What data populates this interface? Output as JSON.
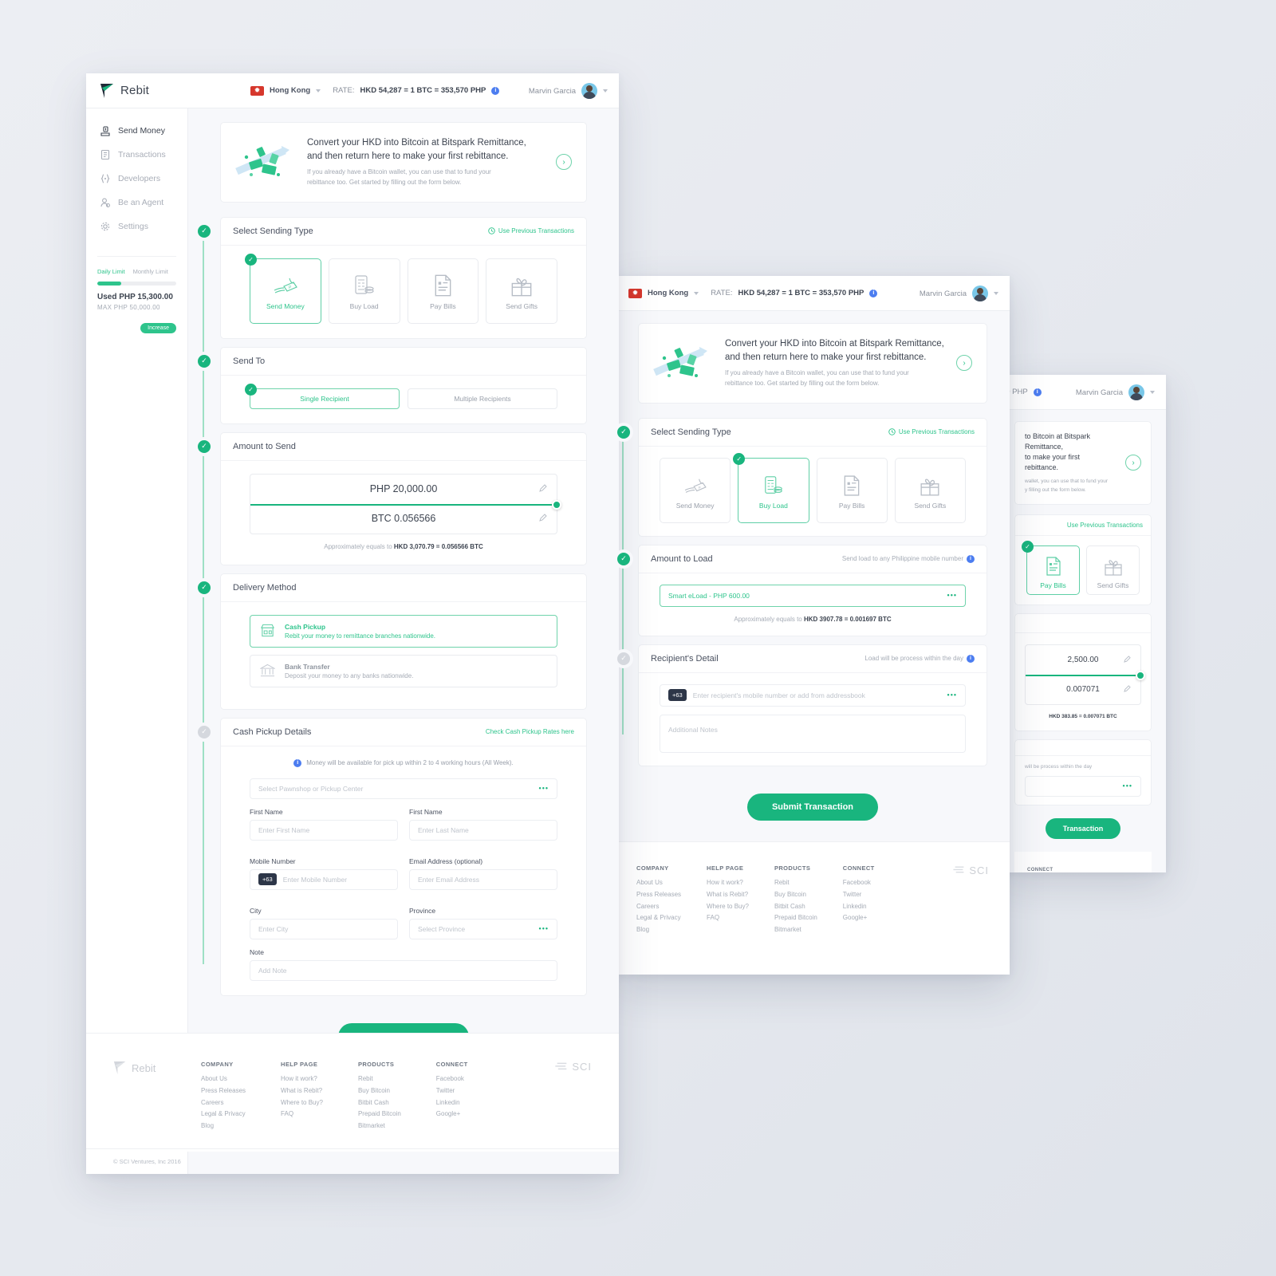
{
  "brand": {
    "name": "Rebit"
  },
  "header": {
    "country": "Hong Kong",
    "rate_prefix": "RATE:",
    "rate": "HKD 54,287 = 1 BTC = 353,570 PHP",
    "user_name": "Marvin Garcia"
  },
  "sidebar": {
    "items": [
      {
        "label": "Send Money",
        "icon": "send-money-icon"
      },
      {
        "label": "Transactions",
        "icon": "transactions-icon"
      },
      {
        "label": "Developers",
        "icon": "developers-icon"
      },
      {
        "label": "Be an Agent",
        "icon": "agent-icon"
      },
      {
        "label": "Settings",
        "icon": "settings-icon"
      }
    ],
    "limit": {
      "tab_daily": "Daily Limit",
      "tab_monthly": "Monthly Limit",
      "used": "Used PHP 15,300.00",
      "max": "MAX  PHP 50,000.00",
      "increase": "Increase",
      "progress_percent": 30
    }
  },
  "promo": {
    "headline_line1": "Convert your HKD into Bitcoin at Bitspark Remittance,",
    "headline_line2": "and then return here to make your first rebittance.",
    "sub_line1": "If you already have a Bitcoin wallet, you can use that to fund your",
    "sub_line2": "rebittance too. Get started by filling out the form below."
  },
  "sending_type": {
    "title": "Select Sending Type",
    "link": "Use Previous Transactions",
    "options": [
      {
        "label": "Send Money",
        "icon": "hand-money-icon"
      },
      {
        "label": "Buy Load",
        "icon": "phone-coins-icon"
      },
      {
        "label": "Pay Bills",
        "icon": "bill-document-icon"
      },
      {
        "label": "Send Gifts",
        "icon": "gift-box-icon"
      }
    ],
    "selected_w1": "Send Money",
    "selected_w2": "Buy Load",
    "selected_w3": "Pay Bills"
  },
  "send_to": {
    "title": "Send To",
    "option_single": "Single Recipient",
    "option_multiple": "Multiple Recipients"
  },
  "amount_to_send": {
    "title": "Amount to Send",
    "php_value": "PHP 20,000.00",
    "btc_value": "BTC 0.056566",
    "approx_prefix": "Approximately equals to",
    "approx_value": "HKD 3,070.79 = 0.056566 BTC"
  },
  "delivery_method": {
    "title": "Delivery Method",
    "options": [
      {
        "name": "Cash Pickup",
        "desc": "Rebit your money to remittance branches nationwide.",
        "icon": "storefront-icon"
      },
      {
        "name": "Bank Transfer",
        "desc": "Deposit your money to any banks nationwide.",
        "icon": "bank-icon"
      }
    ]
  },
  "cash_pickup": {
    "title": "Cash Pickup Details",
    "link": "Check Cash Pickup Rates here",
    "notice": "Money will be available for pick up within 2 to 4 working hours (All Week).",
    "pickup_placeholder": "Select Pawnshop or Pickup Center",
    "label_first_name": "First Name",
    "placeholder_first_name": "Enter First Name",
    "label_last_name": "First Name",
    "placeholder_last_name": "Enter Last Name",
    "label_mobile": "Mobile Number",
    "prefix_mobile": "+63",
    "placeholder_mobile": "Enter Mobile Number",
    "label_email": "Email Address (optional)",
    "placeholder_email": "Enter Email Address",
    "label_city": "City",
    "placeholder_city": "Enter City",
    "label_province": "Province",
    "placeholder_province": "Select Province",
    "label_note": "Note",
    "placeholder_note": "Add Note"
  },
  "amount_to_load": {
    "title": "Amount to Load",
    "note": "Send load to any Philippine mobile number",
    "selected": "Smart eLoad - PHP 600.00",
    "approx_prefix": "Approximately equals to",
    "approx_value": "HKD 3907.78 = 0.001697 BTC"
  },
  "recipient_detail": {
    "title": "Recipient's Detail",
    "note": "Load will be process within the day",
    "prefix": "+63",
    "placeholder_mobile": "Enter recipient's mobile number or add from addressbook",
    "placeholder_notes": "Additional Notes"
  },
  "window3": {
    "amount_php": "2,500.00",
    "amount_btc": "0.007071",
    "approx_value": "HKD 383.85 = 0.007071 BTC",
    "note": "will be process within the day",
    "submit_partial": "Transaction"
  },
  "submit_label": "Submit Transaction",
  "footer": {
    "columns": [
      {
        "heading": "COMPANY",
        "links": [
          "About Us",
          "Press Releases",
          "Careers",
          "Legal & Privacy",
          "Blog"
        ]
      },
      {
        "heading": "HELP PAGE",
        "links": [
          "How it work?",
          "What is Rebit?",
          "Where to Buy?",
          "FAQ"
        ]
      },
      {
        "heading": "PRODUCTS",
        "links": [
          "Rebit",
          "Buy Bitcoin",
          "Bitbit Cash",
          "Prepaid Bitcoin",
          "Bitmarket"
        ]
      },
      {
        "heading": "CONNECT",
        "links": [
          "Facebook",
          "Twitter",
          "Linkedin",
          "Google+"
        ]
      }
    ],
    "partner": "SCI",
    "copyright": "© SCI Ventures, Inc 2016"
  },
  "colors": {
    "accent": "#19b57e",
    "accent_light": "#2ec48c",
    "flag": "#d6372c",
    "info": "#4c7df0"
  }
}
